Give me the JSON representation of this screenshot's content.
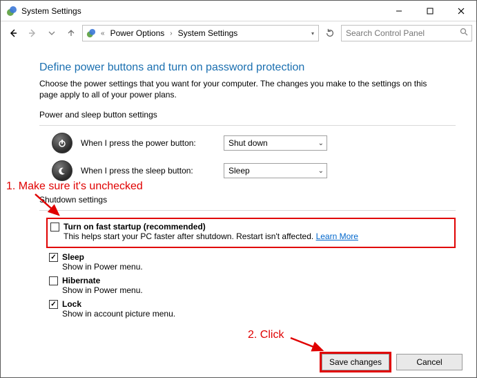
{
  "window": {
    "title": "System Settings"
  },
  "breadcrumb": {
    "items": [
      "Power Options",
      "System Settings"
    ]
  },
  "search": {
    "placeholder": "Search Control Panel"
  },
  "page": {
    "title": "Define power buttons and turn on password protection",
    "intro": "Choose the power settings that you want for your computer. The changes you make to the settings on this page apply to all of your power plans.",
    "section_power_sleep": "Power and sleep button settings",
    "power_button_label": "When I press the power button:",
    "power_button_value": "Shut down",
    "sleep_button_label": "When I press the sleep button:",
    "sleep_button_value": "Sleep",
    "section_shutdown": "Shutdown settings",
    "fast_startup": {
      "title": "Turn on fast startup (recommended)",
      "desc": "This helps start your PC faster after shutdown. Restart isn't affected. ",
      "link": "Learn More",
      "checked": false
    },
    "sleep_opt": {
      "title": "Sleep",
      "desc": "Show in Power menu.",
      "checked": true
    },
    "hibernate_opt": {
      "title": "Hibernate",
      "desc": "Show in Power menu.",
      "checked": false
    },
    "lock_opt": {
      "title": "Lock",
      "desc": "Show in account picture menu.",
      "checked": true
    }
  },
  "buttons": {
    "save": "Save changes",
    "cancel": "Cancel"
  },
  "annotations": {
    "step1": "1. Make sure it's unchecked",
    "step2": "2. Click"
  }
}
